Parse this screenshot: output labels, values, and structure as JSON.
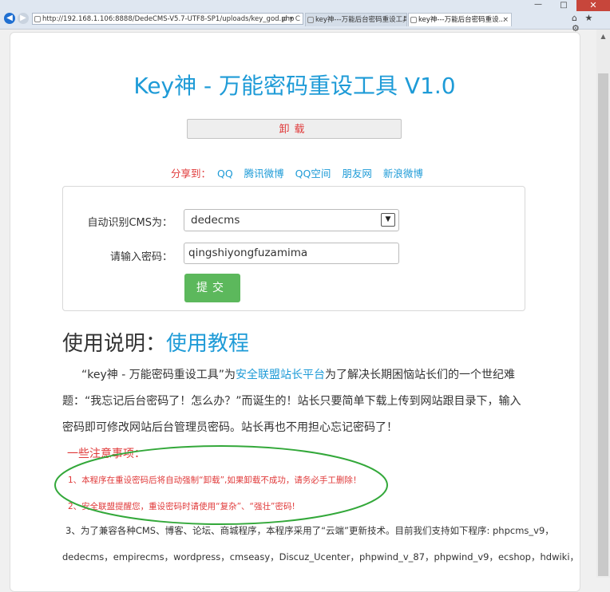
{
  "browser": {
    "url": "http://192.168.1.106:8888/DedeCMS-V5.7-UTF8-SP1/uploads/key_god.php",
    "address_tools": "ρ ▾ C",
    "tabs": [
      {
        "label": "key神---万能后台密码重设工具..."
      },
      {
        "label": "key神---万能后台密码重设..."
      }
    ],
    "tab_close": "×",
    "toolbar_icons": "⌂ ★ ⚙",
    "window_min": "—",
    "window_max": "□",
    "window_close": "✕"
  },
  "page": {
    "title": "Key神 - 万能密码重设工具 V1.0",
    "uninstall_label": "卸载",
    "share": {
      "label": "分享到：",
      "links": [
        "QQ",
        "腾讯微博",
        "QQ空间",
        "朋友网",
        "新浪微博"
      ]
    },
    "form": {
      "cms_label": "自动识别CMS为：",
      "cms_value": "dedecms",
      "password_label": "请输入密码：",
      "password_value": "qingshiyongfuzamima",
      "submit_label": "提交"
    },
    "usage": {
      "heading": "使用说明：",
      "heading_link": "使用教程",
      "para_part1": "“key神 - 万能密码重设工具”为",
      "para_link": "安全联盟站长平台",
      "para_part2": "为了解决长期困恼站长们的一个世纪难题：“我忘记后台密码了！怎么办？”而诞生的！站长只要简单下载上传到网站跟目录下，输入密码即可修改网站后台管理员密码。站长再也不用担心忘记密码了！"
    },
    "notes": {
      "title": "一些注意事项：",
      "items": [
        "1、本程序在重设密码后将自动强制“卸载”,如果卸载不成功，请务必手工删除！",
        "2、安全联盟提醒您，重设密码时请使用“复杂”、“强壮”密码!",
        "3、为了兼容各种CMS、博客、论坛、商城程序，本程序采用了“云端”更新技术。目前我们支持如下程序: phpcms_v9，"
      ],
      "cms_list": "dedecms，empirecms，wordpress，cmseasy，Discuz_Ucenter，phpwind_v_87，phpwind_v9，ecshop，hdwiki，"
    }
  }
}
